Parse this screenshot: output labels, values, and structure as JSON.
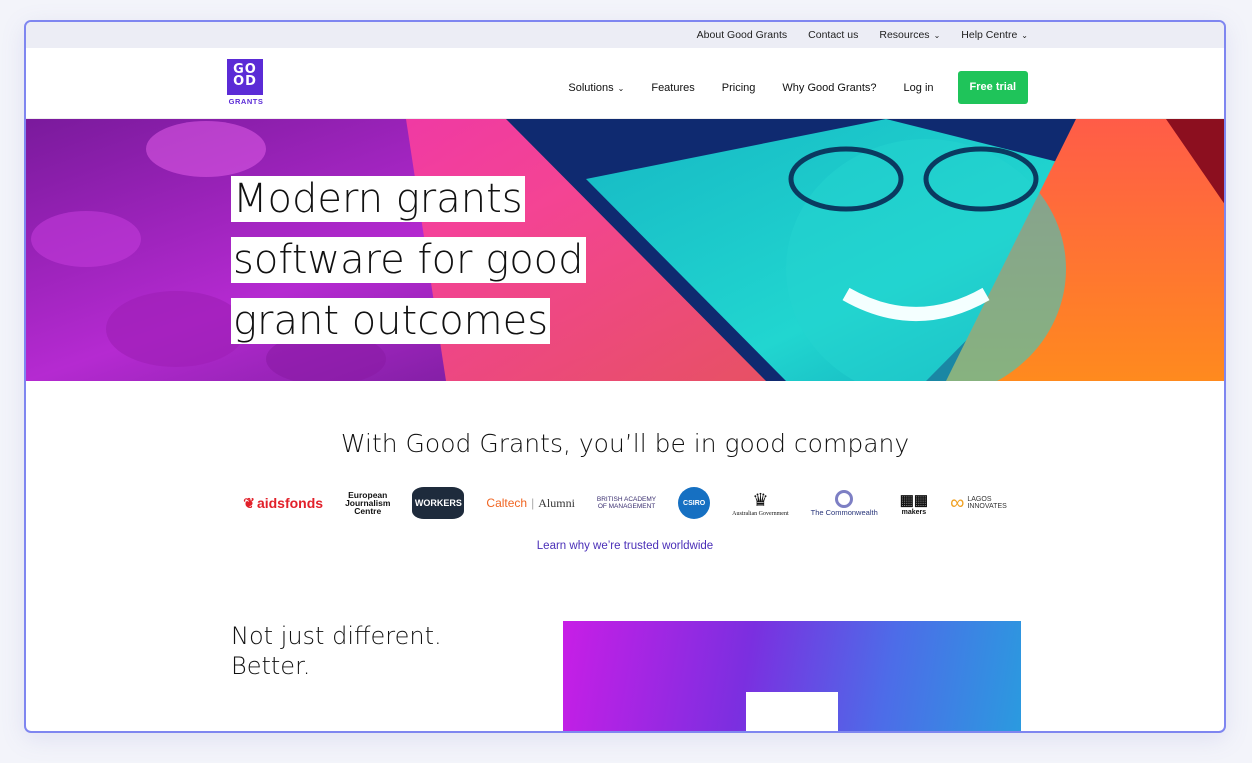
{
  "utility_nav": {
    "about": "About Good Grants",
    "contact": "Contact us",
    "resources": "Resources",
    "help": "Help Centre"
  },
  "logo": {
    "line1": "GO",
    "line2": "OD",
    "sub": "GRANTS"
  },
  "main_nav": {
    "solutions": "Solutions",
    "features": "Features",
    "pricing": "Pricing",
    "why": "Why Good Grants?",
    "login": "Log in",
    "cta": "Free trial"
  },
  "hero": {
    "line1": "Modern grants",
    "line2": "software for good",
    "line3": "grant outcomes"
  },
  "company": {
    "title": "With Good Grants, you’ll be in good company",
    "logos": {
      "aidsfonds": "aidsfonds",
      "ejc1": "European",
      "ejc2": "Journalism",
      "ejc3": "Centre",
      "workers": "WORKERS",
      "caltech": "Caltech",
      "alumni": "Alumni",
      "bam1": "BRITISH ACADEMY",
      "bam2": "OF MANAGEMENT",
      "csiro": "CSIRO",
      "ausgov": "Australian Government",
      "commonwealth": "The Commonwealth",
      "filmmakers": "makers",
      "lagos1": "LAGOS",
      "lagos2": "INNOVATES"
    },
    "learn_link": "Learn why we’re trusted worldwide"
  },
  "section2": {
    "tag1": "Not just different.",
    "tag2": "Better."
  },
  "colors": {
    "brand": "#5b2bd6",
    "cta": "#1fc45a",
    "link": "#4a2fb8"
  }
}
